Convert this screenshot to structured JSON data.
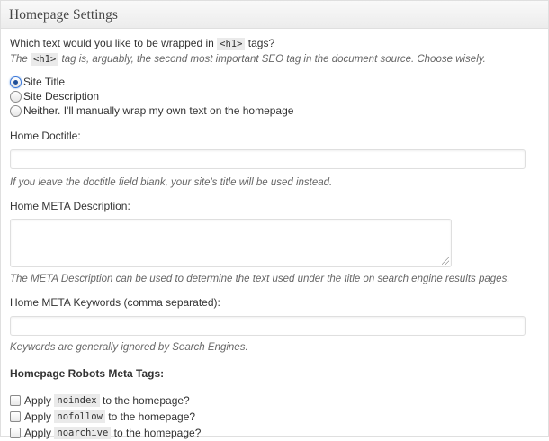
{
  "header": {
    "title": "Homepage Settings"
  },
  "h1_setting": {
    "question_before": "Which text would you like to be wrapped in",
    "question_code": "<h1>",
    "question_after": "tags?",
    "desc_before": "The",
    "desc_code": "<h1>",
    "desc_after": "tag is, arguably, the second most important SEO tag in the document source. Choose wisely.",
    "options": [
      {
        "label": "Site Title",
        "selected": true
      },
      {
        "label": "Site Description",
        "selected": false
      },
      {
        "label": "Neither. I'll manually wrap my own text on the homepage",
        "selected": false
      }
    ]
  },
  "doctitle": {
    "label": "Home Doctitle:",
    "value": "",
    "desc": "If you leave the doctitle field blank, your site's title will be used instead."
  },
  "meta_description": {
    "label": "Home META Description:",
    "value": "",
    "desc": "The META Description can be used to determine the text used under the title on search engine results pages."
  },
  "meta_keywords": {
    "label": "Home META Keywords (comma separated):",
    "value": "",
    "desc": "Keywords are generally ignored by Search Engines."
  },
  "robots": {
    "heading": "Homepage Robots Meta Tags:",
    "items": [
      {
        "before": "Apply",
        "code": "noindex",
        "after": "to the homepage?",
        "checked": false
      },
      {
        "before": "Apply",
        "code": "nofollow",
        "after": "to the homepage?",
        "checked": false
      },
      {
        "before": "Apply",
        "code": "noarchive",
        "after": "to the homepage?",
        "checked": false
      }
    ]
  }
}
